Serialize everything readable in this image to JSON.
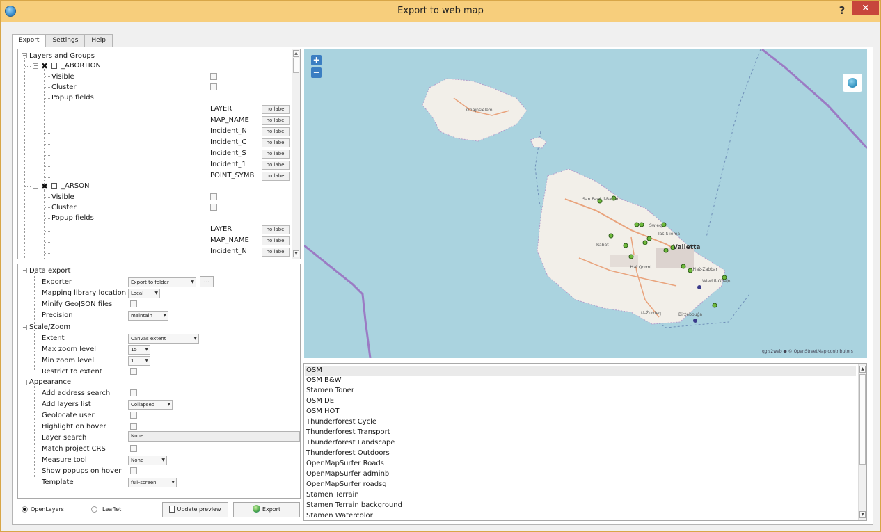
{
  "window": {
    "title": "Export to web map",
    "help_label": "?",
    "close_label": "✕"
  },
  "tabs": [
    {
      "label": "Export",
      "active": true
    },
    {
      "label": "Settings",
      "active": false
    },
    {
      "label": "Help",
      "active": false
    }
  ],
  "layers_tree": {
    "root_label": "Layers and Groups",
    "layers": [
      {
        "name": "_ABORTION",
        "checked": true,
        "visible_label": "Visible",
        "cluster_label": "Cluster",
        "popup_label": "Popup fields",
        "fields": [
          {
            "name": "LAYER",
            "value": "no label"
          },
          {
            "name": "MAP_NAME",
            "value": "no label"
          },
          {
            "name": "Incident_N",
            "value": "no label"
          },
          {
            "name": "Incident_C",
            "value": "no label"
          },
          {
            "name": "Incident_S",
            "value": "no label"
          },
          {
            "name": "Incident_1",
            "value": "no label"
          },
          {
            "name": "POINT_SYMB",
            "value": "no label"
          }
        ]
      },
      {
        "name": "_ARSON",
        "checked": true,
        "visible_label": "Visible",
        "cluster_label": "Cluster",
        "popup_label": "Popup fields",
        "fields": [
          {
            "name": "LAYER",
            "value": "no label"
          },
          {
            "name": "MAP_NAME",
            "value": "no label"
          },
          {
            "name": "Incident_N",
            "value": "no label"
          }
        ]
      }
    ]
  },
  "options": {
    "data_export": {
      "label": "Data export",
      "exporter_label": "Exporter",
      "exporter_value": "Export to folder",
      "browse_label": "...",
      "mapping_label": "Mapping library location",
      "mapping_value": "Local",
      "minify_label": "Minify GeoJSON files",
      "precision_label": "Precision",
      "precision_value": "maintain"
    },
    "scale_zoom": {
      "label": "Scale/Zoom",
      "extent_label": "Extent",
      "extent_value": "Canvas extent",
      "max_label": "Max zoom level",
      "max_value": "15",
      "min_label": "Min zoom level",
      "min_value": "1",
      "restrict_label": "Restrict to extent"
    },
    "appearance": {
      "label": "Appearance",
      "address_label": "Add address search",
      "layers_list_label": "Add layers list",
      "layers_list_value": "Collapsed",
      "geolocate_label": "Geolocate user",
      "highlight_label": "Highlight on hover",
      "layer_search_label": "Layer search",
      "layer_search_value": "None",
      "match_crs_label": "Match project CRS",
      "measure_label": "Measure tool",
      "measure_value": "None",
      "popups_hover_label": "Show popups on hover",
      "template_label": "Template",
      "template_value": "full-screen"
    }
  },
  "bottom": {
    "openlayers_label": "OpenLayers",
    "leaflet_label": "Leaflet",
    "selected": "OpenLayers",
    "update_label": "Update preview",
    "export_label": "Export"
  },
  "map": {
    "zoom_in": "+",
    "zoom_out": "−",
    "attribution": "qgis2web ● © OpenStreetMap contributors",
    "place_labels": [
      "Għajnsielem",
      "San Pawl il-Baħar",
      "Swieqi",
      "Tas-Sliema",
      "Valletta",
      "Rabat",
      "Ħal Qormi",
      "Ħaż-Żabbar",
      "Wied il-Għajn",
      "Iż-Żurrieq",
      "Birżebbuġa"
    ]
  },
  "basemaps": {
    "items": [
      "OSM",
      "OSM B&W",
      "Stamen Toner",
      "OSM DE",
      "OSM HOT",
      "Thunderforest Cycle",
      "Thunderforest Transport",
      "Thunderforest Landscape",
      "Thunderforest Outdoors",
      "OpenMapSurfer Roads",
      "OpenMapSurfer adminb",
      "OpenMapSurfer roadsg",
      "Stamen Terrain",
      "Stamen Terrain background",
      "Stamen Watercolor"
    ],
    "selected": "OSM"
  },
  "colors": {
    "titlebar": "#f7ce7c",
    "close": "#c7463c",
    "water": "#aad3df",
    "land": "#f2efe9",
    "marker": "#6fba3c"
  }
}
